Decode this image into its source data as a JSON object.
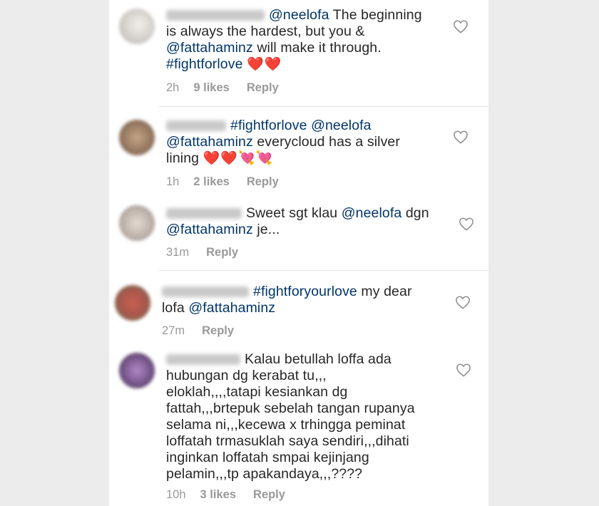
{
  "comments": [
    {
      "line1": "@neelofa The beginning",
      "line1_mention": "@neelofa",
      "line1_rest": " The beginning",
      "line2": "is always the hardest, but you &",
      "line3_mention": "@fattahaminz",
      "line3_rest": " will make it through.",
      "line4_tag": "#fightforlove",
      "line4_emoji": "❤️❤️",
      "time": "2h",
      "likes": "9 likes",
      "reply": "Reply",
      "avatar_color": "#d8d4cf"
    },
    {
      "line1_tag": "#fightforlove",
      "line1_mention": "@neelofa",
      "line2_mention": "@fattahaminz",
      "line2_rest": " everycloud has a silver",
      "line3": "lining",
      "line3_emoji": "❤️❤️💘💘",
      "time": "1h",
      "likes": "2 likes",
      "reply": "Reply",
      "avatar_color": "#9a7d64"
    },
    {
      "line1_rest": "Sweet sgt klau ",
      "line1_mention": "@neelofa",
      "line1_end": " dgn",
      "line2_mention": "@fattahaminz",
      "line2_rest": " je...",
      "time": "31m",
      "reply": "Reply",
      "avatar_color": "#bdb3ab"
    },
    {
      "line1_tag": "#fightforyourlove",
      "line1_rest": " my dear",
      "line2": "lofa ",
      "line2_mention": "@fattahaminz",
      "time": "27m",
      "reply": "Reply",
      "avatar_color": "#a8574c"
    },
    {
      "lines": [
        "Kalau betullah loffa ada",
        "hubungan dg kerabat tu,,,",
        "eloklah,,,,tatapi kesiankan dg",
        "fattah,,,brtepuk sebelah tangan rupanya",
        "selama ni,,,kecewa x trhingga peminat",
        "loffatah trmasuklah saya sendiri,,,dihati",
        "inginkan loffatah smpai kejinjang",
        "pelamin,,,tp apakandaya,,,????"
      ],
      "time": "10h",
      "likes": "3 likes",
      "reply": "Reply",
      "avatar_color": "#7a5a8e"
    }
  ]
}
